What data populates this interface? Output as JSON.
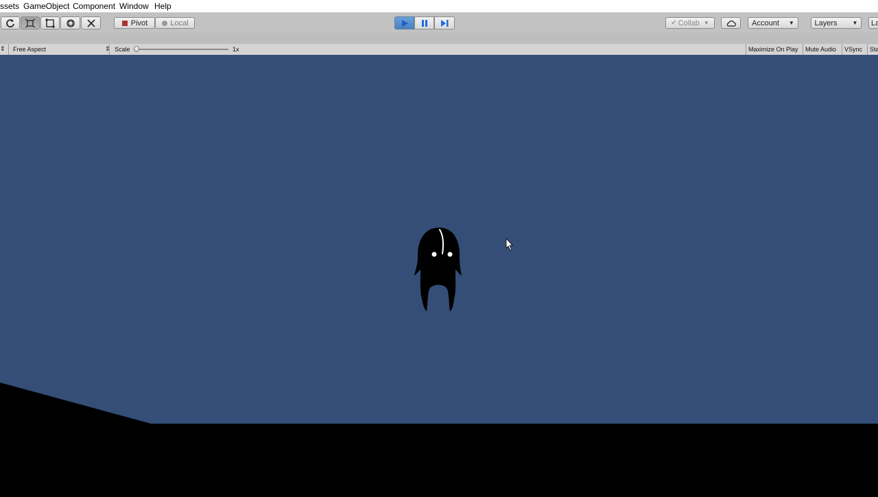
{
  "menu": {
    "items": [
      "ssets",
      "GameObject",
      "Component",
      "Window",
      "Help"
    ]
  },
  "toolbar": {
    "tools": [
      "pan-icon",
      "move-icon",
      "scale-rect-icon",
      "rect-tool-icon",
      "transform-icon"
    ],
    "pivot_label": "Pivot",
    "local_label": "Local",
    "collab_label": "Collab",
    "account_label": "Account",
    "layers_label": "Layers",
    "layout_label": "La"
  },
  "gamebar": {
    "aspect_label": "Free Aspect",
    "scale_label": "Scale",
    "scale_value": "1x",
    "maximize_label": "Maximize On Play",
    "mute_label": "Mute Audio",
    "vsync_label": "VSync",
    "stats_label": "Sta"
  },
  "colors": {
    "sky": "#344e77",
    "ground": "#000000",
    "play_active": "#4a8ed6"
  }
}
